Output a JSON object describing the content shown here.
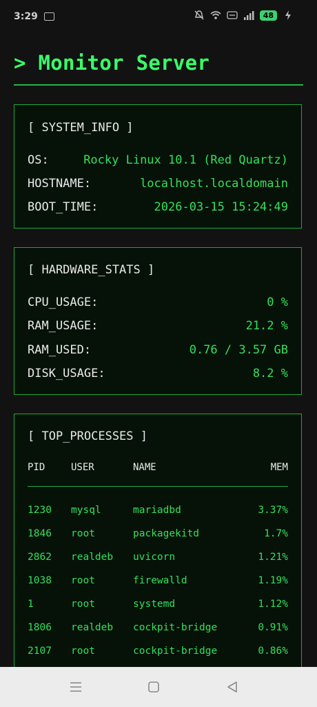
{
  "status_bar": {
    "time": "3:29",
    "battery": "48"
  },
  "app": {
    "title": "> Monitor Server"
  },
  "system_info": {
    "header": "[ SYSTEM_INFO ]",
    "rows": [
      {
        "key": "OS:",
        "value": "Rocky Linux 10.1 (Red Quartz)"
      },
      {
        "key": "HOSTNAME:",
        "value": "localhost.localdomain"
      },
      {
        "key": "BOOT_TIME:",
        "value": "2026-03-15 15:24:49"
      }
    ]
  },
  "hardware_stats": {
    "header": "[ HARDWARE_STATS ]",
    "rows": [
      {
        "key": "CPU_USAGE:",
        "value": "0 %"
      },
      {
        "key": "RAM_USAGE:",
        "value": "21.2 %"
      },
      {
        "key": "RAM_USED:",
        "value": "0.76 / 3.57 GB"
      },
      {
        "key": "DISK_USAGE:",
        "value": "8.2 %"
      }
    ]
  },
  "top_processes": {
    "header": "[ TOP_PROCESSES ]",
    "columns": {
      "pid": "PID",
      "user": "USER",
      "name": "NAME",
      "mem": "MEM"
    },
    "rows": [
      {
        "pid": "1230",
        "user": "mysql",
        "name": "mariadbd",
        "mem": "3.37%"
      },
      {
        "pid": "1846",
        "user": "root",
        "name": "packagekitd",
        "mem": "1.7%"
      },
      {
        "pid": "2862",
        "user": "realdeb",
        "name": "uvicorn",
        "mem": "1.21%"
      },
      {
        "pid": "1038",
        "user": "root",
        "name": "firewalld",
        "mem": "1.19%"
      },
      {
        "pid": "1",
        "user": "root",
        "name": "systemd",
        "mem": "1.12%"
      },
      {
        "pid": "1806",
        "user": "realdeb",
        "name": "cockpit-bridge",
        "mem": "0.91%"
      },
      {
        "pid": "2107",
        "user": "root",
        "name": "cockpit-bridge",
        "mem": "0.86%"
      }
    ]
  },
  "theme": {
    "accent": "#39ff68",
    "background": "#121212",
    "panel_background": "#061208",
    "border": "#1ca83d"
  },
  "icons": [
    "image-icon",
    "dnd-icon",
    "wifi-icon",
    "volte-icon",
    "signal-icon",
    "battery-icon",
    "charging-icon",
    "menu-icon",
    "home-icon",
    "back-icon"
  ]
}
